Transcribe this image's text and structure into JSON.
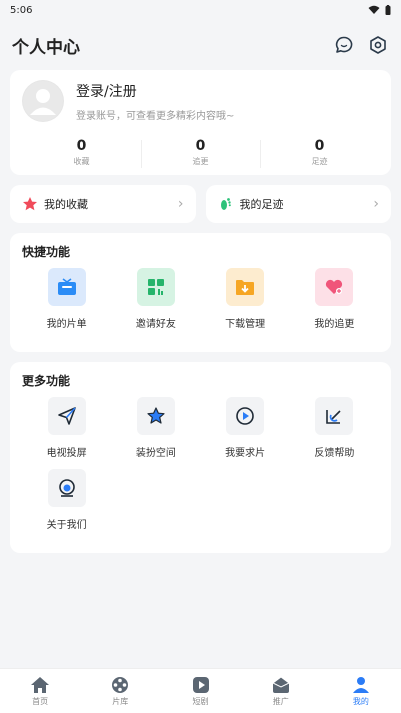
{
  "status": {
    "time": "5:06"
  },
  "header": {
    "title": "个人中心"
  },
  "profile": {
    "login": "登录/注册",
    "subtitle": "登录账号，可查看更多精彩内容哦~",
    "stats": [
      {
        "value": "0",
        "label": "收藏"
      },
      {
        "value": "0",
        "label": "追更"
      },
      {
        "value": "0",
        "label": "足迹"
      }
    ]
  },
  "quick_links": [
    {
      "label": "我的收藏",
      "icon": "star-icon"
    },
    {
      "label": "我的足迹",
      "icon": "footprint-icon"
    }
  ],
  "shortcuts": {
    "title": "快捷功能",
    "items": [
      {
        "label": "我的片单",
        "icon": "tv-icon"
      },
      {
        "label": "邀请好友",
        "icon": "invite-icon"
      },
      {
        "label": "下载管理",
        "icon": "download-folder-icon"
      },
      {
        "label": "我的追更",
        "icon": "heart-icon"
      }
    ]
  },
  "more": {
    "title": "更多功能",
    "items": [
      {
        "label": "电视投屏",
        "icon": "cast-icon"
      },
      {
        "label": "装扮空间",
        "icon": "star-theme-icon"
      },
      {
        "label": "我要求片",
        "icon": "request-icon"
      },
      {
        "label": "反馈帮助",
        "icon": "feedback-icon"
      },
      {
        "label": "关于我们",
        "icon": "about-icon"
      }
    ]
  },
  "tabs": [
    {
      "label": "首页",
      "icon": "home-icon"
    },
    {
      "label": "片库",
      "icon": "film-reel-icon"
    },
    {
      "label": "短剧",
      "icon": "play-icon"
    },
    {
      "label": "推广",
      "icon": "promo-icon"
    },
    {
      "label": "我的",
      "icon": "user-icon",
      "active": true
    }
  ],
  "colors": {
    "accent": "#2b7cf6",
    "star": "#f04b5a",
    "footprint": "#2dc27a"
  }
}
